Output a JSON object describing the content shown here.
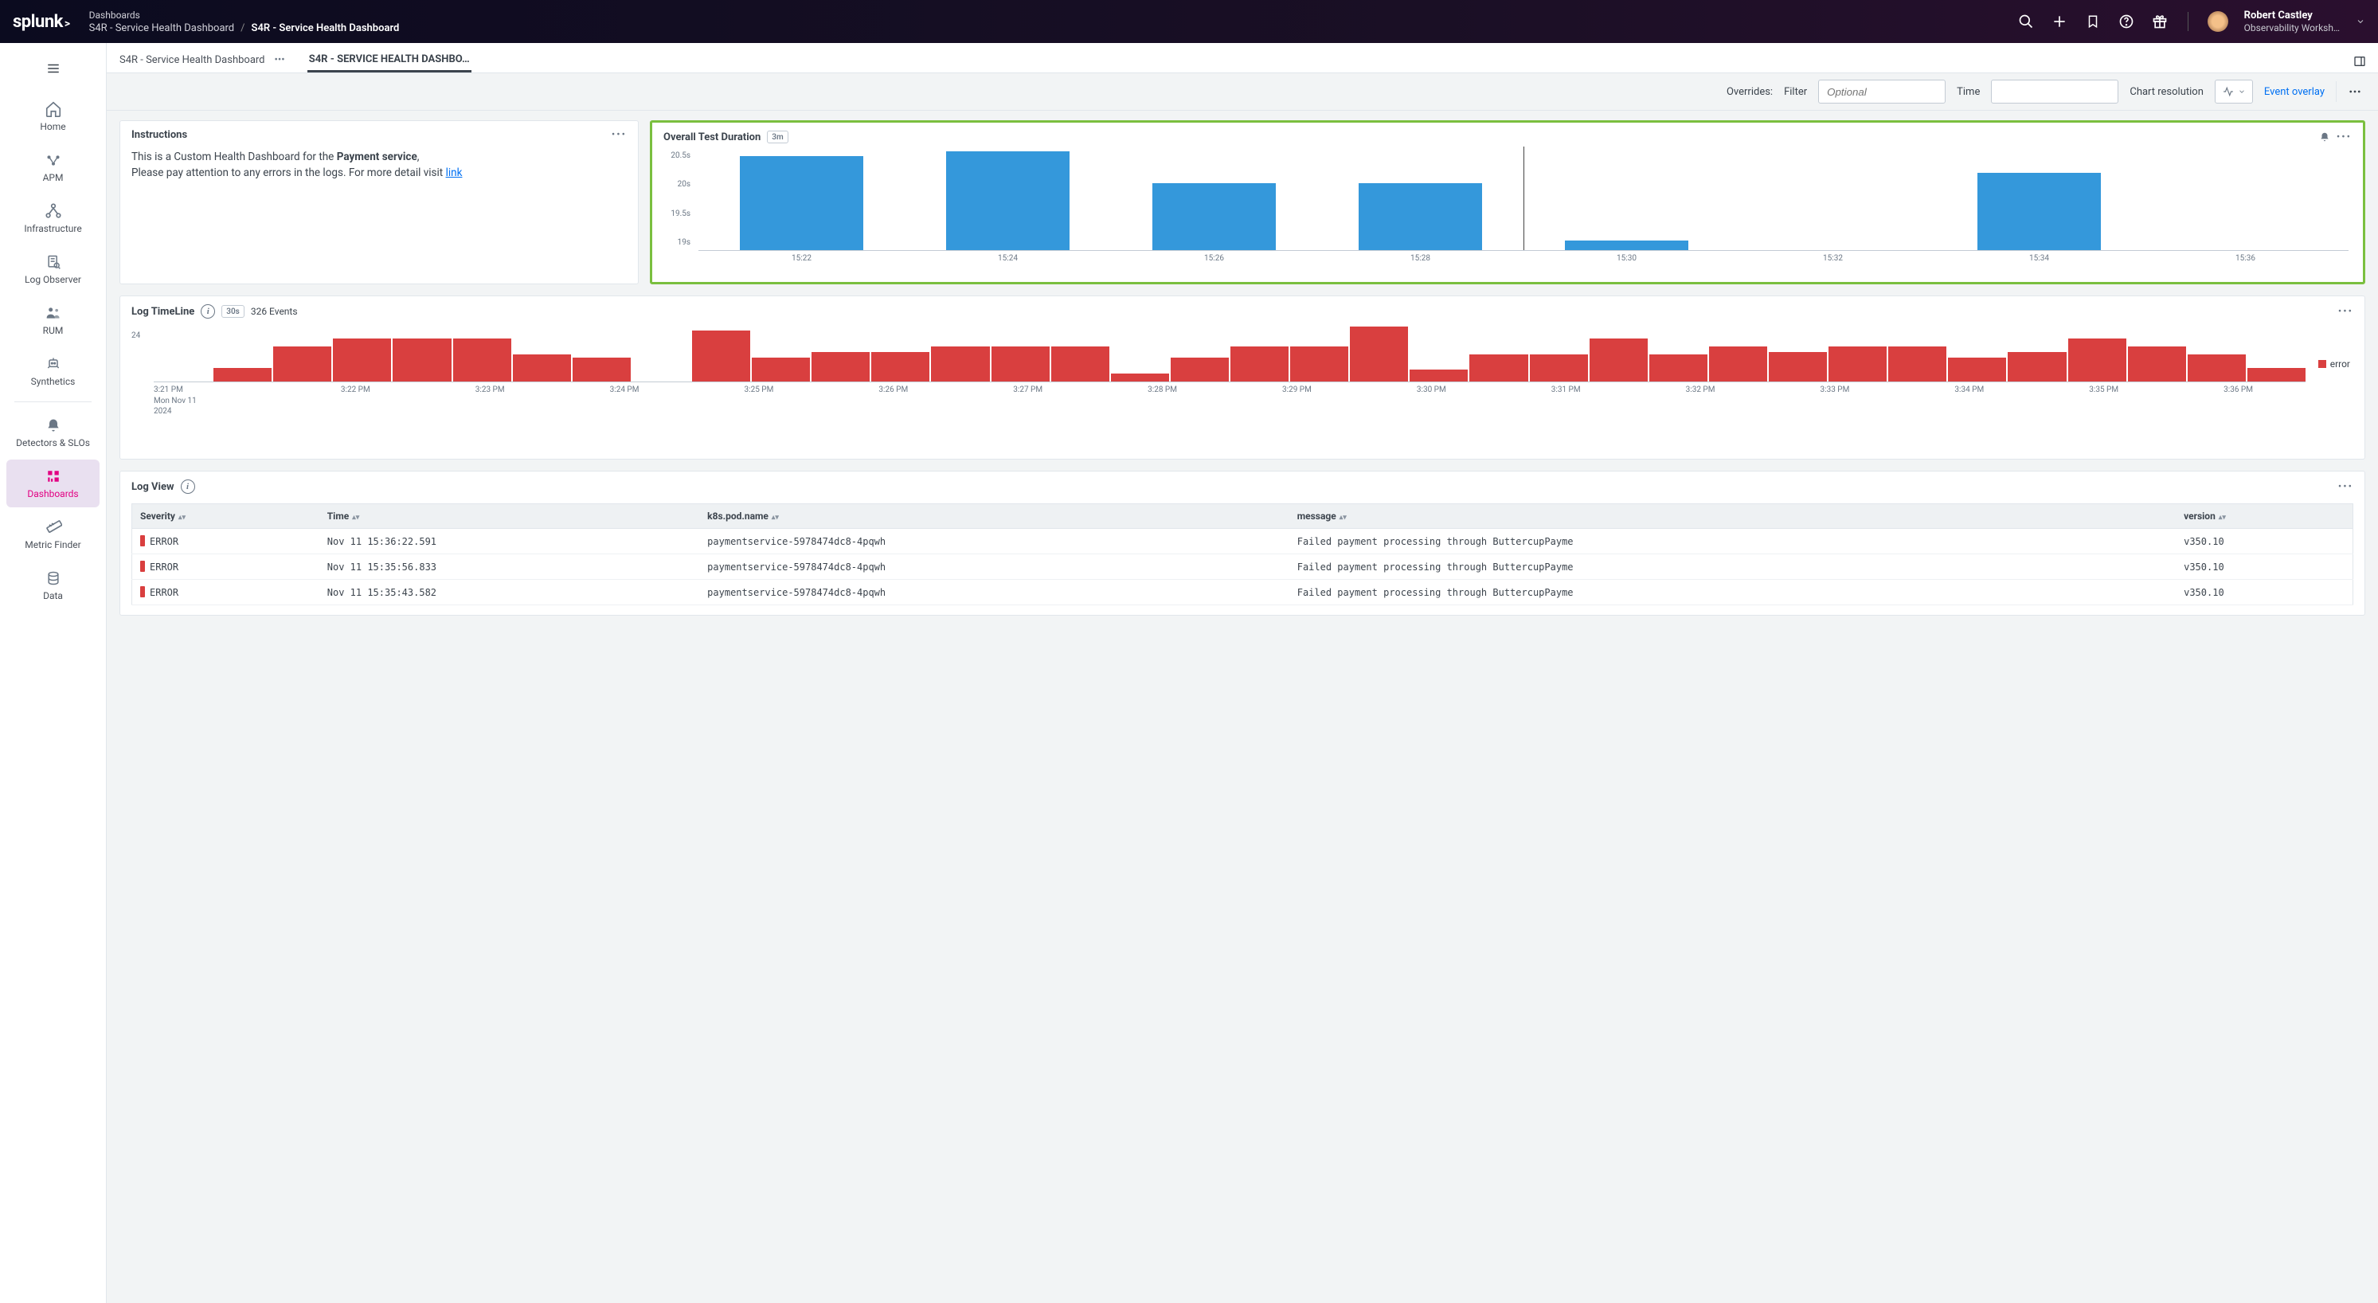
{
  "header": {
    "logo": "splunk",
    "breadcrumb_top": "Dashboards",
    "breadcrumb_parent": "S4R - Service Health Dashboard",
    "breadcrumb_current": "S4R - Service Health Dashboard",
    "user_name": "Robert Castley",
    "user_org": "Observability Worksh…"
  },
  "sidebar": {
    "items": [
      {
        "label": "Home"
      },
      {
        "label": "APM"
      },
      {
        "label": "Infrastructure"
      },
      {
        "label": "Log Observer"
      },
      {
        "label": "RUM"
      },
      {
        "label": "Synthetics"
      },
      {
        "label": "Detectors & SLOs"
      },
      {
        "label": "Dashboards"
      },
      {
        "label": "Metric Finder"
      },
      {
        "label": "Data"
      }
    ]
  },
  "tabs": {
    "items": [
      {
        "label": "S4R - Service Health Dashboard"
      },
      {
        "label": "S4R - SERVICE HEALTH DASHBO…"
      }
    ]
  },
  "overrides": {
    "label": "Overrides:",
    "filter_label": "Filter",
    "filter_placeholder": "Optional",
    "time_label": "Time",
    "chart_res_label": "Chart resolution",
    "event_overlay": "Event overlay"
  },
  "instructions": {
    "title": "Instructions",
    "line1_a": "This is a Custom Health Dashboard for the ",
    "line1_b": "Payment service",
    "line1_c": ",",
    "line2_a": "Please pay attention to any errors in the logs. For more detail visit ",
    "link": "link"
  },
  "overall": {
    "title": "Overall Test Duration",
    "badge": "3m"
  },
  "logtl": {
    "title": "Log TimeLine",
    "interval": "30s",
    "events": "326 Events",
    "legend": "error",
    "date_l1": "Mon Nov 11",
    "date_l2": "2024"
  },
  "logview": {
    "title": "Log View",
    "cols": {
      "severity": "Severity",
      "time": "Time",
      "pod": "k8s.pod.name",
      "message": "message",
      "version": "version"
    },
    "rows": [
      {
        "sev": "ERROR",
        "time": "Nov 11 15:36:22.591",
        "pod": "paymentservice-5978474dc8-4pqwh",
        "msg": "Failed payment processing through ButtercupPayme",
        "ver": "v350.10"
      },
      {
        "sev": "ERROR",
        "time": "Nov 11 15:35:56.833",
        "pod": "paymentservice-5978474dc8-4pqwh",
        "msg": "Failed payment processing through ButtercupPayme",
        "ver": "v350.10"
      },
      {
        "sev": "ERROR",
        "time": "Nov 11 15:35:43.582",
        "pod": "paymentservice-5978474dc8-4pqwh",
        "msg": "Failed payment processing through ButtercupPayme",
        "ver": "v350.10"
      }
    ]
  },
  "chart_data": [
    {
      "type": "bar",
      "name": "Overall Test Duration",
      "yticks": [
        "20.5s",
        "20s",
        "19.5s",
        "19s"
      ],
      "ylim": [
        19,
        21
      ],
      "xticks": [
        "15:22",
        "15:24",
        "15:26",
        "15:28",
        "15:30",
        "15:32",
        "15:34",
        "15:36"
      ],
      "vline_at_index": 4,
      "bars": [
        {
          "x": "15:22",
          "height_s": 20.9,
          "frac": 0.95
        },
        {
          "x": "15:24",
          "height_s": 21.0,
          "frac": 1.0
        },
        {
          "x": "15:26",
          "height_s": 20.3,
          "frac": 0.68
        },
        {
          "x": "15:28",
          "height_s": 20.3,
          "frac": 0.68
        },
        {
          "x": "15:30",
          "height_s": 19.15,
          "frac": 0.1
        },
        {
          "x": "15:32",
          "height_s": null,
          "frac": 0.0
        },
        {
          "x": "15:34",
          "height_s": 20.5,
          "frac": 0.78
        },
        {
          "x": "15:36",
          "height_s": null,
          "frac": 0.0
        }
      ]
    },
    {
      "type": "bar",
      "name": "Log TimeLine",
      "y_max_label": "24",
      "ylim": [
        0,
        28
      ],
      "xticks": [
        "3:21 PM",
        "3:22 PM",
        "3:23 PM",
        "3:24 PM",
        "3:25 PM",
        "3:26 PM",
        "3:27 PM",
        "3:28 PM",
        "3:29 PM",
        "3:30 PM",
        "3:31 PM",
        "3:32 PM",
        "3:33 PM",
        "3:34 PM",
        "3:35 PM",
        "3:36 PM"
      ],
      "series_name": "error",
      "bars": [
        0,
        7,
        18,
        22,
        22,
        22,
        14,
        12,
        0,
        26,
        12,
        15,
        15,
        18,
        18,
        18,
        4,
        12,
        18,
        18,
        28,
        6,
        14,
        14,
        22,
        14,
        18,
        15,
        18,
        18,
        12,
        15,
        22,
        18,
        14,
        7
      ]
    }
  ]
}
